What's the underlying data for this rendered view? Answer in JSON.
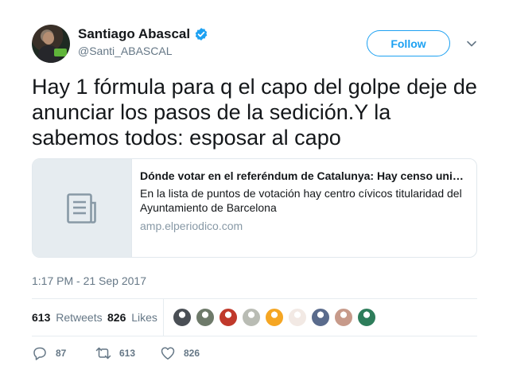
{
  "author": {
    "display_name": "Santiago Abascal",
    "handle": "@Santi_ABASCAL",
    "verified": true
  },
  "follow_button": {
    "label": "Follow"
  },
  "tweet": {
    "text": "Hay 1 fórmula para q el capo del golpe deje de anunciar los pasos de la sedición.Y la sabemos todos: esposar al capo"
  },
  "card": {
    "title": "Dónde votar en el referéndum de Catalunya: Hay censo universal",
    "description": "En la lista de puntos de votación hay centro cívicos titularidad del Ayuntamiento de Barcelona",
    "domain": "amp.elperiodico.com",
    "thumb_icon": "document-icon"
  },
  "timestamp": "1:17 PM - 21 Sep 2017",
  "stats": {
    "retweets_count": "613",
    "retweets_label": "Retweets",
    "likes_count": "826",
    "likes_label": "Likes"
  },
  "likers": [
    {
      "color": "#4a4f55"
    },
    {
      "color": "#6e7a6a"
    },
    {
      "color": "#c0392b"
    },
    {
      "color": "#b9bcb4"
    },
    {
      "color": "#f5a623"
    },
    {
      "color": "#f2e9e4"
    },
    {
      "color": "#5a6b8c"
    },
    {
      "color": "#c79a8a"
    },
    {
      "color": "#2e7d5b"
    }
  ],
  "actions": {
    "reply_count": "87",
    "retweet_count": "613",
    "like_count": "826"
  },
  "colors": {
    "accent": "#1da1f2",
    "text": "#14171a",
    "muted": "#657786"
  }
}
